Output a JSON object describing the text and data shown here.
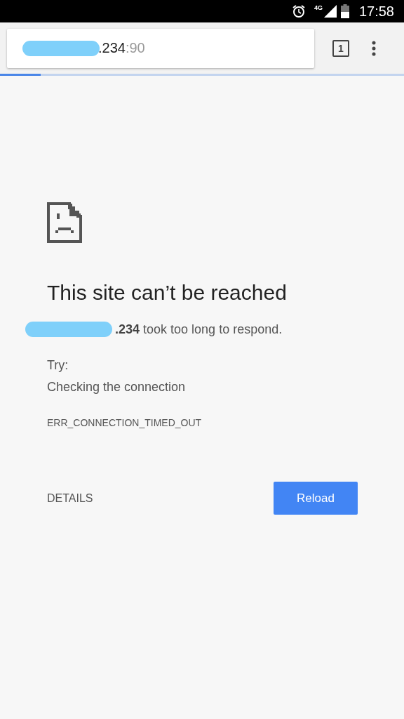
{
  "status_bar": {
    "network": "4G",
    "time": "17:58"
  },
  "toolbar": {
    "url_host": ".234",
    "url_port": ":90",
    "tab_count": "1",
    "redacted": true,
    "progress": {
      "level": 0.1
    }
  },
  "error": {
    "title": "This site can’t be reached",
    "message": "**.234** took too long to respond.",
    "message_redacted": true,
    "try_label": "Try:",
    "suggestion": "Checking the connection",
    "code": "ERR_CONNECTION_TIMED_OUT"
  },
  "actions": {
    "details": "DETAILS",
    "reload": "Reload"
  }
}
